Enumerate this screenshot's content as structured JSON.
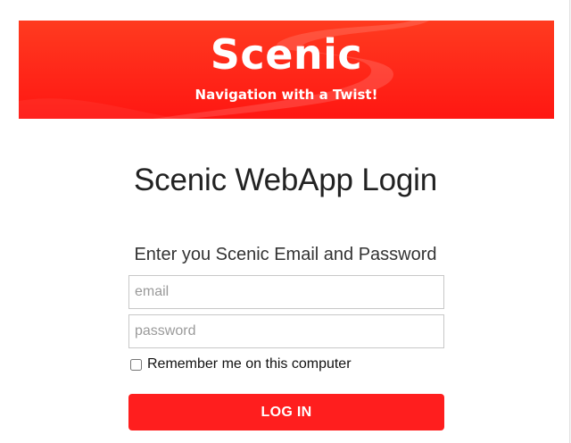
{
  "banner": {
    "brand": "Scenic",
    "tagline": "Navigation with a Twist!",
    "brand_color": "#ff2a1a"
  },
  "login": {
    "title": "Scenic WebApp Login",
    "instructions": "Enter you Scenic Email and Password",
    "email_placeholder": "email",
    "password_placeholder": "password",
    "remember_label": "Remember me on this computer",
    "remember_checked": false,
    "submit_label": "LOG IN",
    "button_color": "#ff1e1e"
  }
}
